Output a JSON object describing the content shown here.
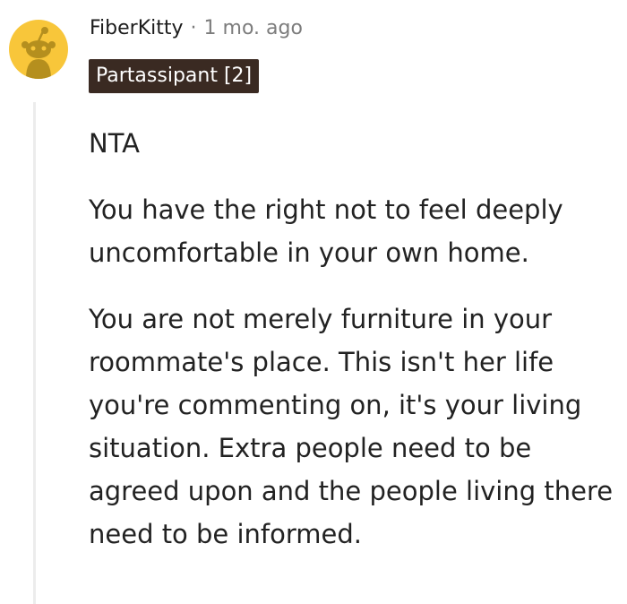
{
  "comment": {
    "author": "FiberKitty",
    "separator": "·",
    "timestamp": "1 mo. ago",
    "flair": "Partassipant [2]",
    "avatar_icon": "reddit-snoo-avatar-icon",
    "avatar_color": "#f8c63a",
    "paragraphs": [
      "NTA",
      "You have the right not to feel deeply uncomfortable in your own home.",
      "You are not merely furniture in your roommate's place. This isn't her life you're commenting on, it's your living situation. Extra people need to be agreed upon and the people living there need to be informed."
    ]
  }
}
